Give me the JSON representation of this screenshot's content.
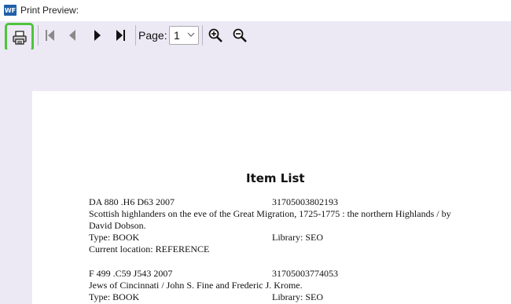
{
  "window": {
    "title": "Print Preview:",
    "app_icon_text": "WF"
  },
  "toolbar": {
    "page_label": "Page:",
    "page_value": "1",
    "icons": [
      "printer-icon",
      "first-page-icon",
      "previous-page-icon",
      "next-page-icon",
      "last-page-icon",
      "zoom-in-icon",
      "zoom-out-icon"
    ]
  },
  "document": {
    "title": "Item List",
    "items": [
      {
        "call_number": "DA 880 .H6 D63 2007",
        "barcode": "31705003802193",
        "title_line1": "Scottish highlanders on the eve of the Great Migration, 1725-1775 : the northern Highlands / by",
        "title_line2": "David Dobson.",
        "type": "Type: BOOK",
        "library": "Library: SEO",
        "location": "Current location: REFERENCE"
      },
      {
        "call_number": "F 499 .C59 J543 2007",
        "barcode": "31705003774053",
        "title_line1": "Jews of Cincinnati / John S. Fine and Frederic J. Krome.",
        "type": "Type: BOOK",
        "library": "Library: SEO"
      }
    ]
  },
  "colors": {
    "highlight": "#4fc33c",
    "background": "#ece9f5",
    "paper": "#ffffff"
  }
}
